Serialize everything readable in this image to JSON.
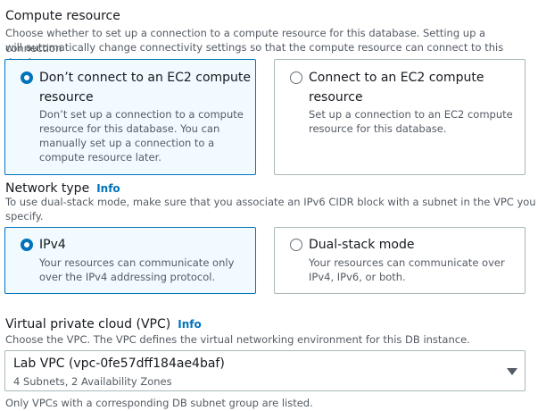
{
  "compute": {
    "title": "Compute resource",
    "description_line1": "Choose whether to set up a connection to a compute resource for this database. Setting up a connection",
    "description_line2": "will automatically change connectivity settings so that the compute resource can connect to this database.",
    "options": [
      {
        "title_line1": "Don’t connect to an EC2 compute",
        "title_line2": "resource",
        "desc_lines": [
          "Don’t set up a connection to a compute",
          "resource for this database. You can",
          "manually set up a connection to a",
          "compute resource later."
        ],
        "selected": true
      },
      {
        "title_line1": "Connect to an EC2 compute",
        "title_line2": "resource",
        "desc_lines": [
          "Set up a connection to an EC2 compute",
          "resource for this database."
        ],
        "selected": false
      }
    ]
  },
  "network": {
    "title": "Network type",
    "info": "Info",
    "description_line1": "To use dual-stack mode, make sure that you associate an IPv6 CIDR block with a subnet in the VPC you",
    "description_line2": "specify.",
    "options": [
      {
        "title": "IPv4",
        "desc_lines": [
          "Your resources can communicate only",
          "over the IPv4 addressing protocol."
        ],
        "selected": true
      },
      {
        "title": "Dual-stack mode",
        "desc_lines": [
          "Your resources can communicate over",
          "IPv4, IPv6, or both."
        ],
        "selected": false
      }
    ]
  },
  "vpc": {
    "title": "Virtual private cloud (VPC)",
    "info": "Info",
    "description": "Choose the VPC. The VPC defines the virtual networking environment for this DB instance.",
    "selected_value": "Lab VPC (vpc-0fe57dff184ae4baf)",
    "selected_detail": "4 Subnets, 2 Availability Zones",
    "footnote": "Only VPCs with a corresponding DB subnet group are listed."
  }
}
